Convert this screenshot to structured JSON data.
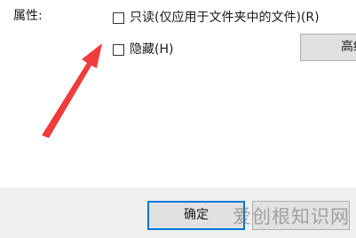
{
  "attributes": {
    "label": "属性:",
    "readonly_checkbox": {
      "label": "只读(仅应用于文件夹中的文件)(R)",
      "checked": false
    },
    "hidden_checkbox": {
      "label": "隐藏(H)",
      "checked": false
    },
    "advanced_button_label": "高级"
  },
  "footer": {
    "ok_label": "确定",
    "cancel_label": ""
  },
  "annotation": {
    "arrow_icon": "red-arrow-icon",
    "arrow_color": "#f03c3c"
  },
  "watermark": {
    "text": "爱创根知识网"
  }
}
